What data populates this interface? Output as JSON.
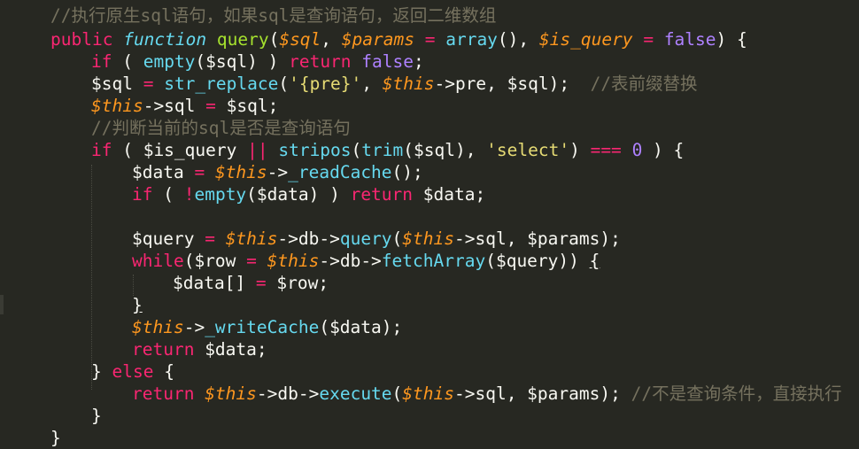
{
  "lines": [
    [
      {
        "t": "//执行原生sql语句，如果sql是查询语句，返回二维数组",
        "c": "cm"
      }
    ],
    [
      {
        "t": "public",
        "c": "kw"
      },
      {
        "t": " ",
        "c": "tx"
      },
      {
        "t": "function",
        "c": "st"
      },
      {
        "t": " ",
        "c": "tx"
      },
      {
        "t": "query",
        "c": "fn"
      },
      {
        "t": "(",
        "c": "tx"
      },
      {
        "t": "$sql",
        "c": "pv"
      },
      {
        "t": ", ",
        "c": "tx"
      },
      {
        "t": "$params",
        "c": "pv"
      },
      {
        "t": " ",
        "c": "tx"
      },
      {
        "t": "=",
        "c": "op"
      },
      {
        "t": " ",
        "c": "tx"
      },
      {
        "t": "array",
        "c": "bi"
      },
      {
        "t": "(), ",
        "c": "tx"
      },
      {
        "t": "$is_query",
        "c": "pv"
      },
      {
        "t": " ",
        "c": "tx"
      },
      {
        "t": "=",
        "c": "op"
      },
      {
        "t": " ",
        "c": "tx"
      },
      {
        "t": "false",
        "c": "cn"
      },
      {
        "t": ") {",
        "c": "tx"
      }
    ],
    [
      {
        "t": "if",
        "c": "kw"
      },
      {
        "t": " ( ",
        "c": "tx"
      },
      {
        "t": "empty",
        "c": "bi"
      },
      {
        "t": "($sql) ) ",
        "c": "tx"
      },
      {
        "t": "return",
        "c": "kw"
      },
      {
        "t": " ",
        "c": "tx"
      },
      {
        "t": "false",
        "c": "cn"
      },
      {
        "t": ";",
        "c": "tx"
      }
    ],
    [
      {
        "t": "$sql ",
        "c": "tx"
      },
      {
        "t": "=",
        "c": "op"
      },
      {
        "t": " ",
        "c": "tx"
      },
      {
        "t": "str_replace",
        "c": "bi"
      },
      {
        "t": "(",
        "c": "tx"
      },
      {
        "t": "'{pre}'",
        "c": "sr"
      },
      {
        "t": ", ",
        "c": "tx"
      },
      {
        "t": "$this",
        "c": "pv"
      },
      {
        "t": "->pre, $sql);  ",
        "c": "tx"
      },
      {
        "t": "//表前缀替换",
        "c": "cm"
      }
    ],
    [
      {
        "t": "$this",
        "c": "pv"
      },
      {
        "t": "->sql ",
        "c": "tx"
      },
      {
        "t": "=",
        "c": "op"
      },
      {
        "t": " $sql;",
        "c": "tx"
      }
    ],
    [
      {
        "t": "//判断当前的sql是否是查询语句",
        "c": "cm"
      }
    ],
    [
      {
        "t": "if",
        "c": "kw"
      },
      {
        "t": " ( $is_query ",
        "c": "tx"
      },
      {
        "t": "||",
        "c": "op"
      },
      {
        "t": " ",
        "c": "tx"
      },
      {
        "t": "stripos",
        "c": "bi"
      },
      {
        "t": "(",
        "c": "tx"
      },
      {
        "t": "trim",
        "c": "bi"
      },
      {
        "t": "($sql), ",
        "c": "tx"
      },
      {
        "t": "'select'",
        "c": "sr"
      },
      {
        "t": ") ",
        "c": "tx"
      },
      {
        "t": "===",
        "c": "op"
      },
      {
        "t": " ",
        "c": "tx"
      },
      {
        "t": "0",
        "c": "cn"
      },
      {
        "t": " ) {",
        "c": "tx"
      }
    ],
    [
      {
        "t": "$data ",
        "c": "tx"
      },
      {
        "t": "=",
        "c": "op"
      },
      {
        "t": " ",
        "c": "tx"
      },
      {
        "t": "$this",
        "c": "pv"
      },
      {
        "t": "->",
        "c": "tx"
      },
      {
        "t": "_readCache",
        "c": "bi"
      },
      {
        "t": "();",
        "c": "tx"
      }
    ],
    [
      {
        "t": "if",
        "c": "kw"
      },
      {
        "t": " ( ",
        "c": "tx"
      },
      {
        "t": "!",
        "c": "op"
      },
      {
        "t": "empty",
        "c": "bi"
      },
      {
        "t": "($data) ) ",
        "c": "tx"
      },
      {
        "t": "return",
        "c": "kw"
      },
      {
        "t": " $data;",
        "c": "tx"
      }
    ],
    [],
    [
      {
        "t": "$query ",
        "c": "tx"
      },
      {
        "t": "=",
        "c": "op"
      },
      {
        "t": " ",
        "c": "tx"
      },
      {
        "t": "$this",
        "c": "pv"
      },
      {
        "t": "->db->",
        "c": "tx"
      },
      {
        "t": "query",
        "c": "bi"
      },
      {
        "t": "(",
        "c": "tx"
      },
      {
        "t": "$this",
        "c": "pv"
      },
      {
        "t": "->sql, $params);",
        "c": "tx"
      }
    ],
    [
      {
        "t": "while",
        "c": "kw"
      },
      {
        "t": "($row ",
        "c": "tx"
      },
      {
        "t": "=",
        "c": "op"
      },
      {
        "t": " ",
        "c": "tx"
      },
      {
        "t": "$this",
        "c": "pv"
      },
      {
        "t": "->db->",
        "c": "tx"
      },
      {
        "t": "fetchArray",
        "c": "bi"
      },
      {
        "t": "($query)) ",
        "c": "tx"
      },
      {
        "t": "{",
        "c": "tx ul"
      }
    ],
    [
      {
        "t": "$data[] ",
        "c": "tx"
      },
      {
        "t": "=",
        "c": "op"
      },
      {
        "t": " $row;",
        "c": "tx"
      }
    ],
    [
      {
        "t": "}",
        "c": "tx ul"
      }
    ],
    [
      {
        "t": "$this",
        "c": "pv"
      },
      {
        "t": "->",
        "c": "tx"
      },
      {
        "t": "_writeCache",
        "c": "bi"
      },
      {
        "t": "($data);",
        "c": "tx"
      }
    ],
    [
      {
        "t": "return",
        "c": "kw"
      },
      {
        "t": " $data;",
        "c": "tx"
      }
    ],
    [
      {
        "t": "} ",
        "c": "tx"
      },
      {
        "t": "else",
        "c": "kw"
      },
      {
        "t": " {",
        "c": "tx"
      }
    ],
    [
      {
        "t": "return",
        "c": "kw"
      },
      {
        "t": " ",
        "c": "tx"
      },
      {
        "t": "$this",
        "c": "pv"
      },
      {
        "t": "->db->",
        "c": "tx"
      },
      {
        "t": "execute",
        "c": "bi"
      },
      {
        "t": "(",
        "c": "tx"
      },
      {
        "t": "$this",
        "c": "pv"
      },
      {
        "t": "->sql, $params); ",
        "c": "tx"
      },
      {
        "t": "//不是查询条件，直接执行",
        "c": "cm"
      }
    ],
    [
      {
        "t": "}",
        "c": "tx"
      }
    ],
    [
      {
        "t": "}",
        "c": "tx"
      }
    ]
  ],
  "colors": {
    "background": "#272822",
    "comment": "#75715e",
    "keyword": "#f92672",
    "storage": "#66d9ef",
    "function_name": "#a6e22e",
    "builtin": "#66d9ef",
    "variable": "#fd971f",
    "constant": "#ae81ff",
    "string": "#e6db74",
    "text": "#f8f8f2"
  }
}
